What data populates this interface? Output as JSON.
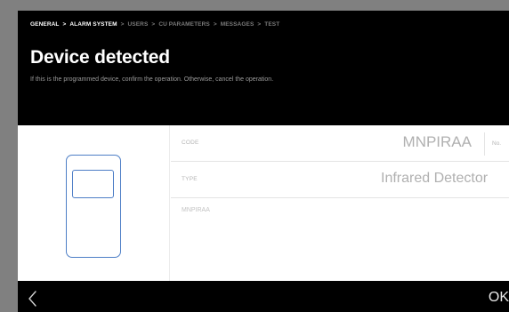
{
  "breadcrumb": {
    "items": [
      {
        "label": "GENERAL",
        "active": true
      },
      {
        "label": "ALARM SYSTEM",
        "active": true
      },
      {
        "label": "USERS",
        "active": false
      },
      {
        "label": "CU PARAMETERS",
        "active": false
      },
      {
        "label": "MESSAGES",
        "active": false
      },
      {
        "label": "TEST",
        "active": false
      }
    ],
    "separator": ">"
  },
  "header": {
    "title": "Device detected",
    "subtitle": "If this is the programmed device, confirm the operation. Otherwise, cancel the operation."
  },
  "device": {
    "code_label": "CODE",
    "code_value": "MNPIRAA",
    "no_label": "No.",
    "type_label": "TYPE",
    "type_value": "Infrared Detector",
    "code_echo": "MNPIRAA"
  },
  "footer": {
    "back_icon": "chevron-left-icon",
    "ok_label": "OK"
  },
  "colors": {
    "screen_background": "#000000",
    "bezel": "#808080",
    "device_outline": "#4d7ec6",
    "active_crumb": "#ffffff",
    "inactive_crumb": "#7a7a7a",
    "field_value": "#b0b0b0"
  }
}
